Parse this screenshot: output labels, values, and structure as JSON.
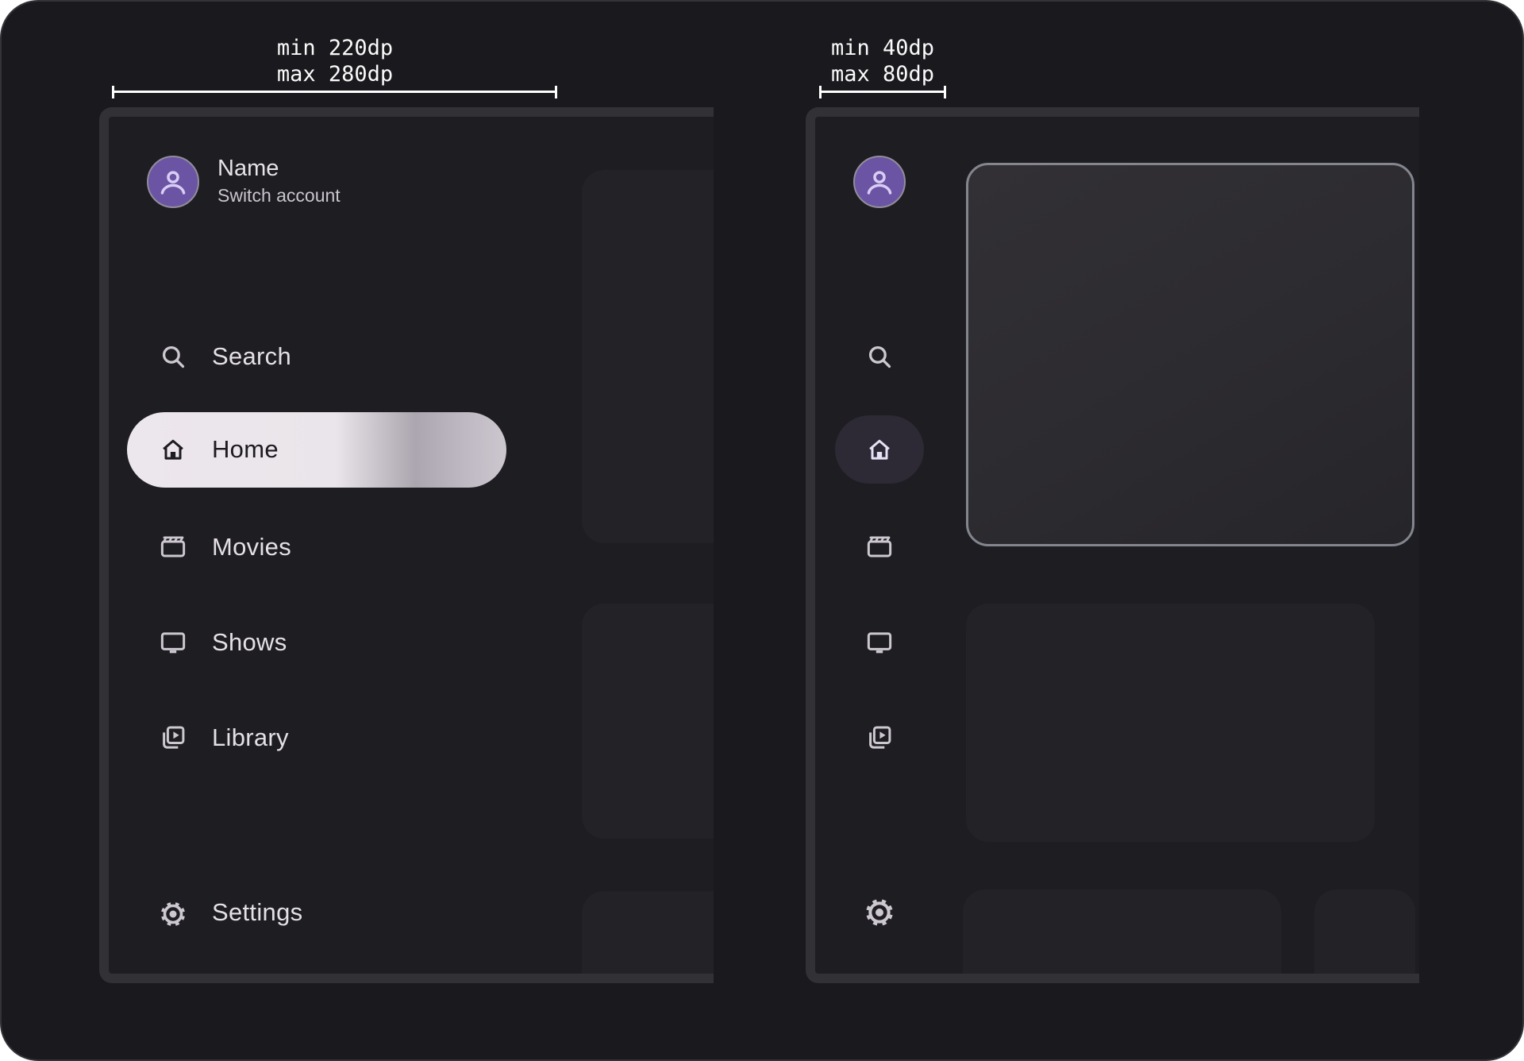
{
  "annotations": {
    "expanded_drawer": {
      "line1": "min 220dp",
      "line2": "max 280dp"
    },
    "collapsed_rail": {
      "line1": "min 40dp",
      "line2": "max 80dp"
    }
  },
  "account": {
    "name": "Name",
    "subtitle": "Switch account",
    "avatar_icon": "person-icon"
  },
  "nav_items": [
    {
      "id": "search",
      "label": "Search",
      "icon": "search-icon",
      "selected": false
    },
    {
      "id": "home",
      "label": "Home",
      "icon": "home-icon",
      "selected": true
    },
    {
      "id": "movies",
      "label": "Movies",
      "icon": "movie-icon",
      "selected": false
    },
    {
      "id": "shows",
      "label": "Shows",
      "icon": "tv-icon",
      "selected": false
    },
    {
      "id": "library",
      "label": "Library",
      "icon": "library-icon",
      "selected": false
    }
  ],
  "footer_items": [
    {
      "id": "settings",
      "label": "Settings",
      "icon": "settings-icon",
      "selected": false
    }
  ],
  "colors": {
    "page_background": "#1a191d",
    "panel_background": "#1e1d22",
    "panel_border": "#323136",
    "selected_pill_start": "#ece7ec",
    "selected_pill_fade": "#aba6af",
    "on_pill_text": "#1d1b20",
    "label_text": "#e4e0e6",
    "icon_color": "#cdc8d0",
    "avatar_background": "#6a54a3",
    "avatar_ring": "#928d9b",
    "avatar_glyph": "#d9cdf6",
    "rail_indicator": "#2d2935",
    "placeholder_card": "#232227",
    "focus_card_border": "#83868e",
    "annotation_text": "#fafafa"
  }
}
